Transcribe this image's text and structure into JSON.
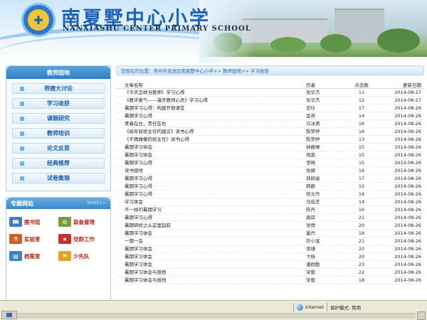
{
  "header": {
    "school_name_cn": "南夏墅中心小学",
    "school_name_en": "NANXIASHU CENTER PRIMARY SCHOOL",
    "logo_glyph": "✚"
  },
  "sidebar": {
    "title": "教师园地",
    "items": [
      {
        "label": "师德大讨论"
      },
      {
        "label": "学习收获"
      },
      {
        "label": "课题研究"
      },
      {
        "label": "教师培训"
      },
      {
        "label": "论文反思"
      },
      {
        "label": "经典推荐"
      },
      {
        "label": "试卷集锦"
      }
    ],
    "links_title": "专题网站",
    "links_more": "MORE>>",
    "links": [
      {
        "label": "图书馆",
        "icon": "book-icon",
        "color": "#3c7fc9",
        "glyph": "📖"
      },
      {
        "label": "装备管理",
        "icon": "equipment-icon",
        "color": "#7a9b3a",
        "glyph": "⚙"
      },
      {
        "label": "实验室",
        "icon": "lab-icon",
        "color": "#d45a2b",
        "glyph": "⚗"
      },
      {
        "label": "党群工作",
        "icon": "party-icon",
        "color": "#c9302c",
        "glyph": "★"
      },
      {
        "label": "档案室",
        "icon": "archive-icon",
        "color": "#3a83c4",
        "glyph": "▤"
      },
      {
        "label": "少先队",
        "icon": "pioneer-icon",
        "color": "#e0a325",
        "glyph": "⚑"
      }
    ]
  },
  "main": {
    "breadcrumb": "您现在的位置：常州市武进区南夏墅中心小学>> 教师园地>> 学习收获",
    "columns": {
      "title": "文章名称",
      "author": "作者",
      "views": "点击数",
      "date": "更新日期"
    },
    "rows": [
      {
        "title": "《今天怎样当教师》学习心得",
        "author": "张华杰",
        "views": "11",
        "date": "2014-08-27"
      },
      {
        "title": "《教学勇气——漫步教师心灵》学习心得",
        "author": "张华杰",
        "views": "12",
        "date": "2014-08-27"
      },
      {
        "title": "暑期学习心得：构建开放课堂",
        "author": "史玲",
        "views": "17",
        "date": "2014-08-26"
      },
      {
        "title": "暑期学习心得",
        "author": "金燕",
        "views": "14",
        "date": "2014-08-26"
      },
      {
        "title": "青春在左，责任在右",
        "author": "许冰倩",
        "views": "16",
        "date": "2014-08-26"
      },
      {
        "title": "《给年轻班主任的建议》读书心得",
        "author": "殷梦婷",
        "views": "16",
        "date": "2014-08-26"
      },
      {
        "title": "《不再做懒的班主任》读书心得",
        "author": "殷梦婷",
        "views": "13",
        "date": "2014-08-26"
      },
      {
        "title": "暑期学习体会",
        "author": "钟静峰",
        "views": "15",
        "date": "2014-08-26"
      },
      {
        "title": "暑期学习体会",
        "author": "周菡",
        "views": "15",
        "date": "2014-08-26"
      },
      {
        "title": "暑期学习心得",
        "author": "李畅",
        "views": "15",
        "date": "2014-08-26"
      },
      {
        "title": "读书感悟",
        "author": "张娜",
        "views": "16",
        "date": "2014-08-26"
      },
      {
        "title": "暑期学习心得",
        "author": "郭佩瑜",
        "views": "17",
        "date": "2014-08-26"
      },
      {
        "title": "暑期学习心得",
        "author": "韩静",
        "views": "15",
        "date": "2014-08-26"
      },
      {
        "title": "暑期学习心得",
        "author": "蒋文丹",
        "views": "16",
        "date": "2014-08-26"
      },
      {
        "title": "学习体会",
        "author": "马瑶芝",
        "views": "14",
        "date": "2014-08-26"
      },
      {
        "title": "不一样的暑期学习",
        "author": "陈丹",
        "views": "16",
        "date": "2014-08-26"
      },
      {
        "title": "暑期学习心得",
        "author": "唐琪",
        "views": "21",
        "date": "2014-08-26"
      },
      {
        "title": "暑期研修之从这里起航",
        "author": "张倩",
        "views": "20",
        "date": "2014-08-26"
      },
      {
        "title": "暑期学习体会",
        "author": "巢丹",
        "views": "18",
        "date": "2014-08-26"
      },
      {
        "title": "一期一会",
        "author": "符小宝",
        "views": "21",
        "date": "2014-08-26"
      },
      {
        "title": "暑期学习体会",
        "author": "李珊",
        "views": "20",
        "date": "2014-08-26"
      },
      {
        "title": "暑期学习体会",
        "author": "卞杨",
        "views": "20",
        "date": "2014-08-26"
      },
      {
        "title": "暑期学习体会",
        "author": "潘群勤",
        "views": "23",
        "date": "2014-08-26"
      },
      {
        "title": "暑期学习体会与感悟",
        "author": "宋蓉",
        "views": "22",
        "date": "2014-08-26"
      },
      {
        "title": "暑期学习体会与感悟",
        "author": "宋蓉",
        "views": "18",
        "date": "2014-08-26"
      }
    ]
  },
  "statusbar": {
    "zone": "Internet",
    "protected_mode": "保护模式: 禁用"
  }
}
